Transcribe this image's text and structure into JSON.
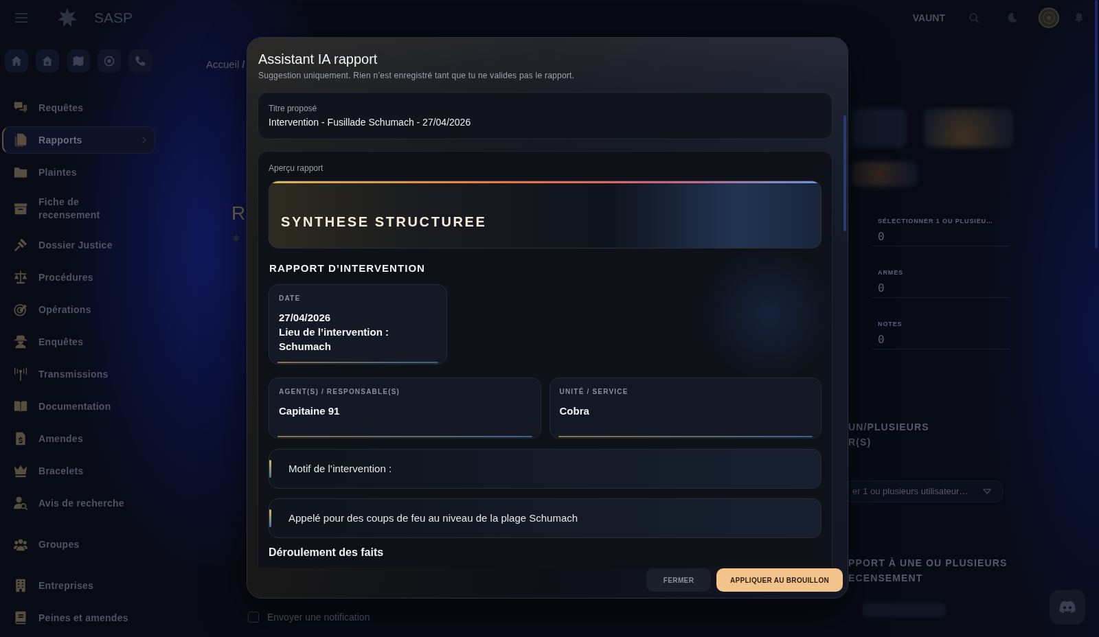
{
  "topbar": {
    "brand": "SASP",
    "user_name": "VAUNT"
  },
  "sidebar": {
    "sections": [
      {
        "items": [
          {
            "label": "Requêtes",
            "selected": false
          },
          {
            "label": "Rapports",
            "selected": true
          },
          {
            "label": "Plaintes",
            "selected": false
          },
          {
            "label": "Fiche de recensement",
            "selected": false
          },
          {
            "label": "Dossier Justice",
            "selected": false
          },
          {
            "label": "Procédures",
            "selected": false
          },
          {
            "label": "Opérations",
            "selected": false
          },
          {
            "label": "Enquêtes",
            "selected": false
          },
          {
            "label": "Transmissions",
            "selected": false
          },
          {
            "label": "Documentation",
            "selected": false
          },
          {
            "label": "Amendes",
            "selected": false
          },
          {
            "label": "Bracelets",
            "selected": false
          },
          {
            "label": "Avis de recherche",
            "selected": false
          }
        ]
      },
      {
        "items": [
          {
            "label": "Groupes",
            "selected": false
          }
        ]
      },
      {
        "items": [
          {
            "label": "Entreprises",
            "selected": false
          },
          {
            "label": "Peines et amendes",
            "selected": false
          }
        ]
      }
    ]
  },
  "breadcrumb": [
    "Accueil",
    "/"
  ],
  "page_title": "R",
  "report_form": {
    "counters": [
      {
        "label": "SÉLECTIONNER 1 OU PLUSIEU…",
        "value": "0"
      },
      {
        "label": "ARMES",
        "value": "0"
      },
      {
        "label": "NOTES",
        "value": "0"
      }
    ],
    "link_users": {
      "heading": "UN/PLUSIEURS R(S)",
      "placeholder": "er 1 ou plusieurs utilisateur…"
    },
    "link_census": {
      "heading": "PPORT À UNE OU PLUSIEURS ECENSEMENT"
    },
    "notify": {
      "label": "Envoyer une notification",
      "checked": false
    }
  },
  "modal": {
    "title": "Assistant IA rapport",
    "subtitle": "Suggestion uniquement. Rien n’est enregistré tant que tu ne valides pas le rapport.",
    "proposed_title": {
      "label": "Titre proposé",
      "value": "Intervention - Fusillade Schumach - 27/04/2026"
    },
    "preview": {
      "label": "Aperçu rapport",
      "banner": "SYNTHESE STRUCTUREE",
      "heading": "RAPPORT D’INTERVENTION",
      "field_rows": [
        [
          {
            "label": "DATE",
            "lines": [
              "27/04/2026",
              "Lieu de l’intervention : Schumach"
            ]
          }
        ],
        [
          {
            "label": "AGENT(S) / RESPONSABLE(S)",
            "lines": [
              "Capitaine 91"
            ]
          },
          {
            "label": "UNITÉ / SERVICE",
            "lines": [
              "Cobra"
            ]
          }
        ]
      ],
      "paragraphs": [
        "Motif de l’intervention :",
        "Appelé pour des coups de feu au niveau de la plage Schumach"
      ],
      "next_heading": "Déroulement des faits"
    },
    "buttons": [
      {
        "label": "FERMER",
        "kind": "secondary"
      },
      {
        "label": "APPLIQUER AU BROUILLON",
        "kind": "primary"
      }
    ]
  }
}
